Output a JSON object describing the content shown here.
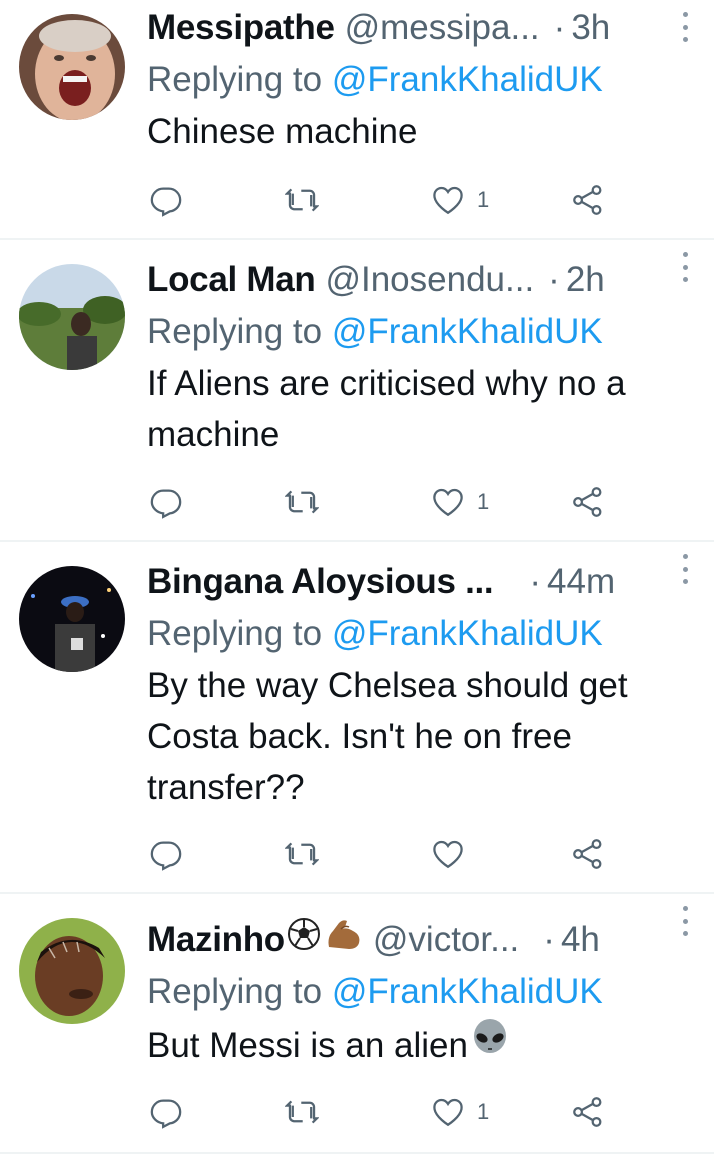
{
  "tweets": [
    {
      "name": "Messipathe",
      "handle": "@messipa...",
      "dot": "·",
      "time": "3h",
      "replying_prefix": "Replying to ",
      "replying_to": "@FrankKhalidUK",
      "text": "Chinese machine",
      "likes": "1"
    },
    {
      "name": "Local Man",
      "handle": "@Inosendu...",
      "dot": "·",
      "time": "2h",
      "replying_prefix": "Replying to ",
      "replying_to": "@FrankKhalidUK",
      "text": "If Aliens are criticised why no a machine",
      "likes": "1"
    },
    {
      "name": "Bingana Aloysious ...",
      "handle": "",
      "dot": "·",
      "time": "44m",
      "replying_prefix": "Replying to ",
      "replying_to": "@FrankKhalidUK",
      "text": "By the way Chelsea should get Costa back. Isn't he on free transfer??",
      "likes": ""
    },
    {
      "name": "Mazinho",
      "handle": "@victor...",
      "dot": "·",
      "time": "4h",
      "replying_prefix": "Replying to ",
      "replying_to": "@FrankKhalidUK",
      "text": "But Messi is an alien",
      "likes": "1"
    }
  ],
  "icons": {
    "reply": "reply-icon",
    "retweet": "retweet-icon",
    "like": "heart-icon",
    "share": "share-icon",
    "more": "more-options-icon"
  },
  "colors": {
    "link": "#1d9bf0",
    "secondary": "#536471",
    "text": "#0f1419",
    "divider": "#eff3f4"
  }
}
